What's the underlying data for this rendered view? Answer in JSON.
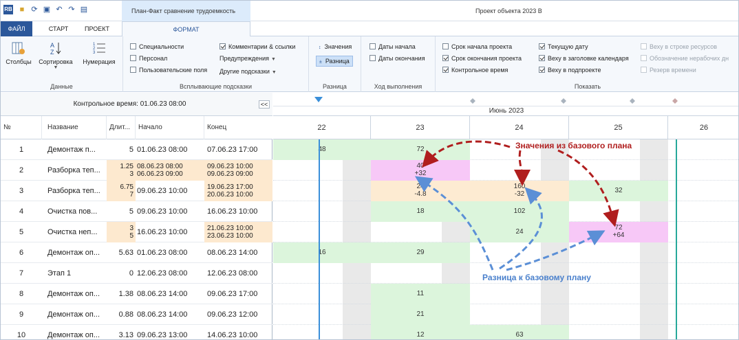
{
  "window": {
    "title": "Проект объекта 2023 В",
    "context_tab": "План-Факт сравнение трудоемкость"
  },
  "tabs": [
    "ФАЙЛ",
    "СТАРТ",
    "ПРОЕКТ",
    "ФОРМАТ"
  ],
  "ribbon": {
    "data_group": {
      "label": "Данные",
      "columns": "Столбцы",
      "sort": "Сортировка",
      "numbering": "Нумерация"
    },
    "tooltips_group": {
      "label": "Всплывающие подсказки",
      "specialties": "Специальности",
      "personnel": "Персонал",
      "custom_fields": "Пользовательские поля",
      "comments": "Комментарии & ссылки",
      "warnings": "Предупреждения",
      "other": "Другие подсказки"
    },
    "diff_group": {
      "label": "Разница",
      "values": "Значения",
      "difference": "Разница"
    },
    "progress_group": {
      "label": "Ход выполнения",
      "start_dates": "Даты начала",
      "end_dates": "Даты окончания"
    },
    "show_group": {
      "label": "Показать",
      "project_start": "Срок начала проекта",
      "project_end": "Срок окончания проекта",
      "control_time": "Контрольное время",
      "current_date": "Текущую дату",
      "calendar_header": "Веху в заголовке календаря",
      "subproject": "Веху в подпроекте",
      "resource_row": "Веху в строке ресурсов",
      "nonwork": "Обозначение нерабочих дн",
      "time_reserve": "Резерв времени"
    }
  },
  "grid": {
    "control_time": "Контрольное время: 01.06.23 08:00",
    "collapse": "<<",
    "headers": {
      "num": "№",
      "name": "Название",
      "dur": "Длит...",
      "start": "Начало",
      "end": "Конец"
    },
    "rows": [
      {
        "num": "1",
        "name": "Демонтаж  п...",
        "dur": "5",
        "start": "01.06.23 08:00",
        "end": "07.06.23 17:00"
      },
      {
        "num": "2",
        "name": "Разборка теп...",
        "dur": "1.25",
        "dur2": "3",
        "start": "08.06.23 08:00",
        "start2": "06.06.23 09:00",
        "end": "09.06.23 10:00",
        "end2": "09.06.23 09:00"
      },
      {
        "num": "3",
        "name": "Разборка теп...",
        "dur": "6.75",
        "dur2": "7",
        "start": "09.06.23 10:00",
        "end": "19.06.23 17:00",
        "end2": "20.06.23 10:00"
      },
      {
        "num": "4",
        "name": "Очистка пов...",
        "dur": "5",
        "start": "09.06.23 10:00",
        "end": "16.06.23 10:00"
      },
      {
        "num": "5",
        "name": "Очистка неп...",
        "dur": "3",
        "dur2": "5",
        "start": "16.06.23 10:00",
        "end": "21.06.23 10:00",
        "end2": "23.06.23 10:00"
      },
      {
        "num": "6",
        "name": "Демонтаж оп...",
        "dur": "5.63",
        "start": "01.06.23 08:00",
        "end": "08.06.23 14:00"
      },
      {
        "num": "7",
        "name": "Этап 1",
        "dur": "0",
        "start": "12.06.23 08:00",
        "end": "12.06.23 08:00"
      },
      {
        "num": "8",
        "name": "Демонтаж оп...",
        "dur": "1.38",
        "start": "08.06.23 14:00",
        "end": "09.06.23 17:00"
      },
      {
        "num": "9",
        "name": "Демонтаж оп...",
        "dur": "0.88",
        "start": "08.06.23 14:00",
        "end": "09.06.23 12:00"
      },
      {
        "num": "10",
        "name": "Демонтаж оп...",
        "dur": "3.13",
        "start": "09.06.23 13:00",
        "end": "14.06.23 10:00"
      }
    ]
  },
  "gantt": {
    "month": "Июнь 2023",
    "days": [
      "22",
      "23",
      "24",
      "25",
      "26"
    ],
    "cells": {
      "r1": [
        "48",
        "72"
      ],
      "r2": [
        "40",
        "+32"
      ],
      "r3": [
        "24",
        "-4.8",
        "160",
        "-32",
        "32"
      ],
      "r4": [
        "18",
        "102"
      ],
      "r5": [
        "24",
        "72",
        "+64"
      ],
      "r6": [
        "16",
        "29"
      ],
      "r8": [
        "11"
      ],
      "r9": [
        "21"
      ],
      "r10": [
        "12",
        "63"
      ]
    }
  },
  "annotations": {
    "baseline_values": "Значения из базового плана",
    "baseline_diff": "Разница к базовому плану"
  },
  "colors": {
    "accent": "#2b579a",
    "green_cell": "#dcf5dc",
    "pink_cell": "#f7c8f7",
    "orange_cell": "#fdebd2",
    "red_arrow": "#b01e1e",
    "blue_arrow": "#5b8fd6"
  }
}
